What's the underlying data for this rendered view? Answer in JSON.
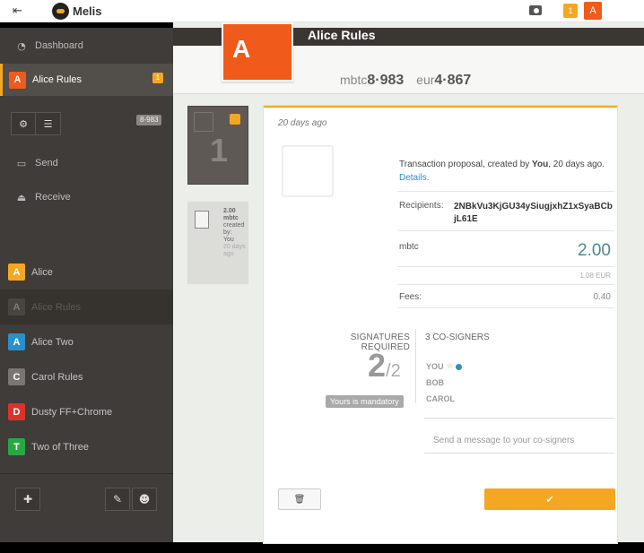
{
  "app": {
    "name": "Melis"
  },
  "topbar": {
    "notifications_count": "1",
    "user_initial": "A"
  },
  "sidebar": {
    "dashboard_label": "Dashboard",
    "active_wallet": {
      "initial": "A",
      "name": "Alice Rules",
      "badge": "1",
      "color": "#f05a1a"
    },
    "balance": "8-983",
    "send_label": "Send",
    "receive_label": "Receive",
    "wallets": [
      {
        "initial": "A",
        "name": "Alice",
        "color": "#f5a623"
      },
      {
        "initial": "A",
        "name": "Alice Rules",
        "color": "#4a4744"
      },
      {
        "initial": "A",
        "name": "Alice Two",
        "color": "#2b8fc9"
      },
      {
        "initial": "C",
        "name": "Carol Rules",
        "color": "#7a7672"
      },
      {
        "initial": "D",
        "name": "Dusty FF+Chrome",
        "color": "#d9342b"
      },
      {
        "initial": "T",
        "name": "Two of Three",
        "color": "#27a844"
      }
    ]
  },
  "header": {
    "wallet_initial": "A",
    "wallet_name": "Alice Rules",
    "mbtc_unit": "mbtc",
    "mbtc_value": "8·983",
    "eur_unit": "eur",
    "eur_value": "4·867"
  },
  "proposal_list": {
    "count": "1",
    "card_amount": "2.00",
    "card_unit": "mbtc",
    "card_created": "created by:",
    "card_by": "You",
    "card_ago": "20 days ago"
  },
  "proposal": {
    "ago": "20 days ago",
    "desc_prefix": "Transaction proposal, created by ",
    "desc_you": "You",
    "desc_suffix": ", 20 days ago. ",
    "details_link": "Details.",
    "recipients_label": "Recipients:",
    "recipient_address": "2NBkVu3KjGU34ySiugjxhZ1xSyaBCbjL61E",
    "amount_unit": "mbtc",
    "amount": "2.00",
    "amount_eur": "1.08 EUR",
    "fees_label": "Fees:",
    "fees": "0.40",
    "signatures_title": "SIGNATURES REQUIRED",
    "signatures_have": "2",
    "signatures_of": "/2",
    "mandatory_label": "Yours is mandatory",
    "cosigners_title": "3 CO-SIGNERS",
    "cosigners": [
      "YOU",
      "BOB",
      "CAROL"
    ],
    "message_placeholder": "Send a message to your co-signers"
  },
  "colors": {
    "accent": "#f5a623",
    "brand_orange": "#f05a1a",
    "sidebar_bg": "#3f3c39",
    "link": "#2b8fc9"
  }
}
